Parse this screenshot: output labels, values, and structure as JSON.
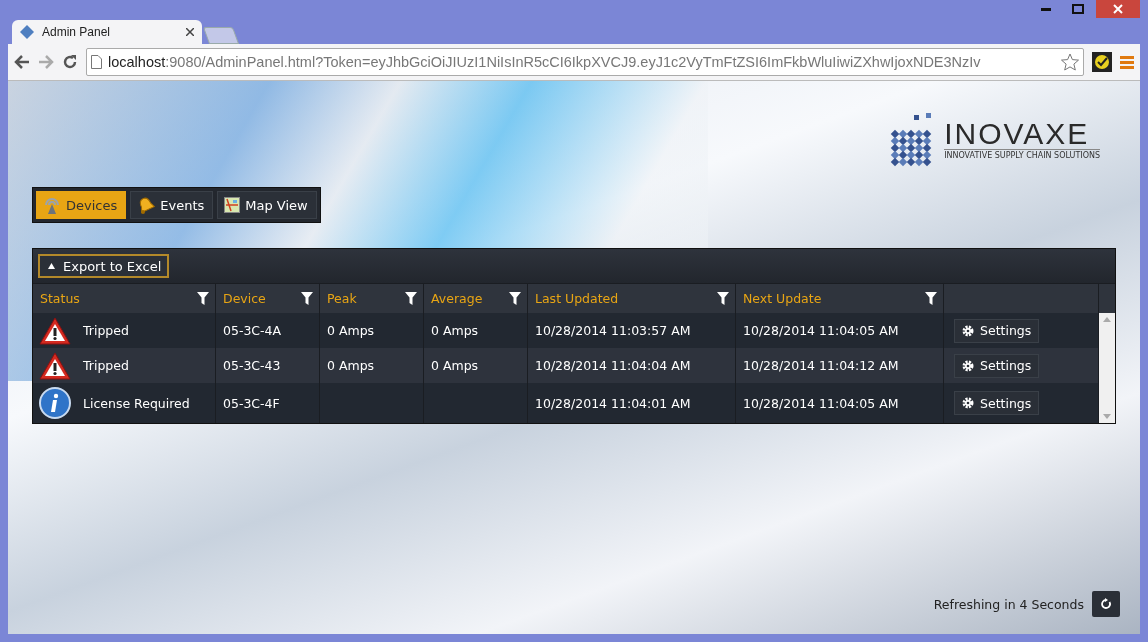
{
  "browser": {
    "tab_title": "Admin Panel",
    "address_host": "localhost",
    "address_rest": ":9080/AdminPanel.html?Token=eyJhbGciOiJIUzI1NiIsInR5cCI6IkpXVCJ9.eyJ1c2VyTmFtZSI6ImFkbWluIiwiZXhwIjoxNDE3NzIv"
  },
  "logo": {
    "name": "INOVAXE",
    "tagline": "INNOVATIVE SUPPLY CHAIN SOLUTIONS"
  },
  "nav_tabs": [
    {
      "label": "Devices",
      "kind": "antenna",
      "selected": true
    },
    {
      "label": "Events",
      "kind": "bell",
      "selected": false
    },
    {
      "label": "Map View",
      "kind": "map",
      "selected": false
    }
  ],
  "grid": {
    "toolbar_button": "Export to Excel",
    "columns": [
      "Status",
      "Device",
      "Peak",
      "Average",
      "Last Updated",
      "Next Update"
    ],
    "rows": [
      {
        "kind": "warning",
        "status": "Tripped",
        "device": "05-3C-4A",
        "peak": "0 Amps",
        "average": "0 Amps",
        "last_updated": "10/28/2014 11:03:57 AM",
        "next_update": "10/28/2014 11:04:05 AM",
        "action": "Settings"
      },
      {
        "kind": "warning",
        "status": "Tripped",
        "device": "05-3C-43",
        "peak": "0 Amps",
        "average": "0 Amps",
        "last_updated": "10/28/2014 11:04:04 AM",
        "next_update": "10/28/2014 11:04:12 AM",
        "action": "Settings"
      },
      {
        "kind": "info",
        "status": "License Required",
        "device": "05-3C-4F",
        "last_updated": "10/28/2014 11:04:01 AM",
        "next_update": "10/28/2014 11:04:05 AM",
        "action": "Settings"
      }
    ]
  },
  "refresh": {
    "text": "Refreshing in 4 Seconds"
  }
}
